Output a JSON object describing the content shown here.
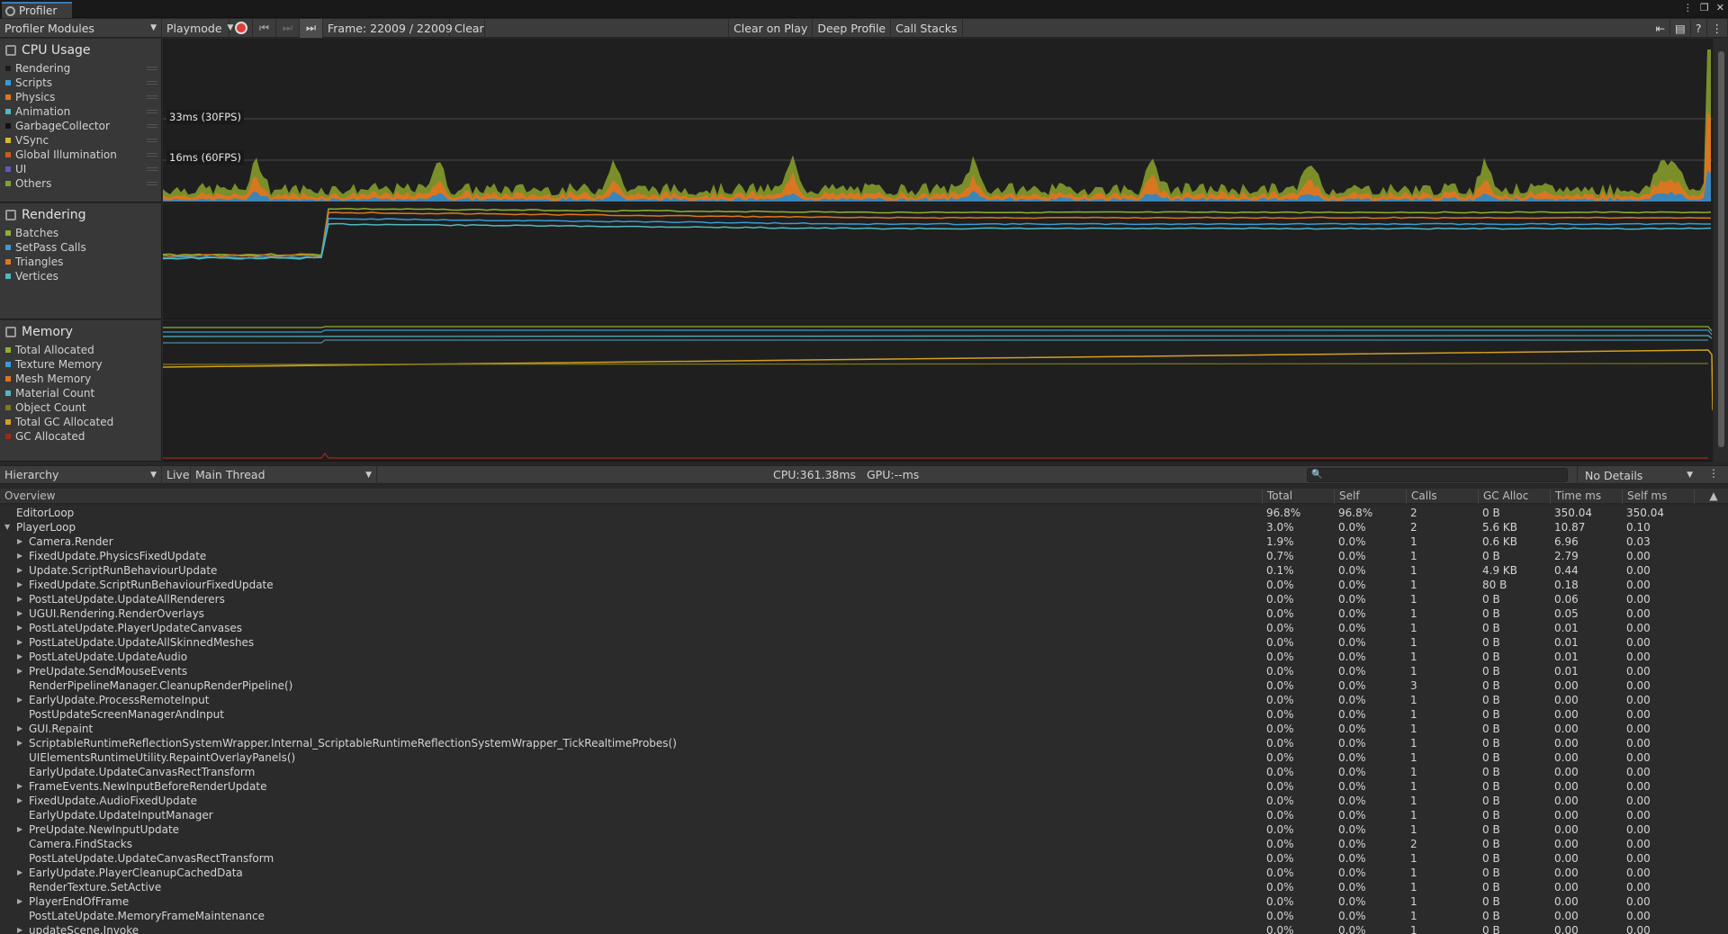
{
  "window": {
    "tab_title": "Profiler"
  },
  "toolbar": {
    "modules_label": "Profiler Modules",
    "playmode_label": "Playmode",
    "frame_label": "Frame: 22009 / 22009",
    "clear": "Clear",
    "clear_on_play": "Clear on Play",
    "deep_profile": "Deep Profile",
    "call_stacks": "Call Stacks"
  },
  "cpu_module": {
    "title": "CPU Usage",
    "legend": [
      {
        "name": "Rendering",
        "color": "#1c1c1c"
      },
      {
        "name": "Scripts",
        "color": "#3a9bd4"
      },
      {
        "name": "Physics",
        "color": "#e0761c"
      },
      {
        "name": "Animation",
        "color": "#4fb8c0"
      },
      {
        "name": "GarbageCollector",
        "color": "#111111"
      },
      {
        "name": "VSync",
        "color": "#d3b92a"
      },
      {
        "name": "Global Illumination",
        "color": "#cc5a1e"
      },
      {
        "name": "UI",
        "color": "#5d5ab8"
      },
      {
        "name": "Others",
        "color": "#7fa32c"
      }
    ],
    "fps_30": "33ms (30FPS)",
    "fps_60": "16ms (60FPS)"
  },
  "rendering_module": {
    "title": "Rendering",
    "legend": [
      {
        "name": "Batches",
        "color": "#8fb02d"
      },
      {
        "name": "SetPass Calls",
        "color": "#3a9bd4"
      },
      {
        "name": "Triangles",
        "color": "#e0761c"
      },
      {
        "name": "Vertices",
        "color": "#4fb8c0"
      }
    ]
  },
  "memory_module": {
    "title": "Memory",
    "legend": [
      {
        "name": "Total Allocated",
        "color": "#8fb02d"
      },
      {
        "name": "Texture Memory",
        "color": "#3a9bd4"
      },
      {
        "name": "Mesh Memory",
        "color": "#e0761c"
      },
      {
        "name": "Material Count",
        "color": "#4fb8c0"
      },
      {
        "name": "Object Count",
        "color": "#7c7a1c"
      },
      {
        "name": "Total GC Allocated",
        "color": "#d3a020"
      },
      {
        "name": "GC Allocated",
        "color": "#9c2a1c"
      }
    ]
  },
  "details_toolbar": {
    "view": "Hierarchy",
    "live": "Live",
    "thread": "Main Thread",
    "cpu_gpu": "CPU:361.38ms   GPU:--ms",
    "search_placeholder": "",
    "details": "No Details"
  },
  "table": {
    "headers": [
      "Overview",
      "Total",
      "Self",
      "Calls",
      "GC Alloc",
      "Time ms",
      "Self ms"
    ],
    "rows": [
      {
        "name": "EditorLoop",
        "depth": 0,
        "exp": "",
        "total": "96.8%",
        "self": "96.8%",
        "calls": "2",
        "gc": "0 B",
        "time": "350.04",
        "selfms": "350.04"
      },
      {
        "name": "PlayerLoop",
        "depth": 0,
        "exp": "▼",
        "total": "3.0%",
        "self": "0.0%",
        "calls": "2",
        "gc": "5.6 KB",
        "time": "10.87",
        "selfms": "0.10"
      },
      {
        "name": "Camera.Render",
        "depth": 1,
        "exp": "▶",
        "total": "1.9%",
        "self": "0.0%",
        "calls": "1",
        "gc": "0.6 KB",
        "time": "6.96",
        "selfms": "0.03"
      },
      {
        "name": "FixedUpdate.PhysicsFixedUpdate",
        "depth": 1,
        "exp": "▶",
        "total": "0.7%",
        "self": "0.0%",
        "calls": "1",
        "gc": "0 B",
        "time": "2.79",
        "selfms": "0.00"
      },
      {
        "name": "Update.ScriptRunBehaviourUpdate",
        "depth": 1,
        "exp": "▶",
        "total": "0.1%",
        "self": "0.0%",
        "calls": "1",
        "gc": "4.9 KB",
        "time": "0.44",
        "selfms": "0.00"
      },
      {
        "name": "FixedUpdate.ScriptRunBehaviourFixedUpdate",
        "depth": 1,
        "exp": "▶",
        "total": "0.0%",
        "self": "0.0%",
        "calls": "1",
        "gc": "80 B",
        "time": "0.18",
        "selfms": "0.00"
      },
      {
        "name": "PostLateUpdate.UpdateAllRenderers",
        "depth": 1,
        "exp": "▶",
        "total": "0.0%",
        "self": "0.0%",
        "calls": "1",
        "gc": "0 B",
        "time": "0.06",
        "selfms": "0.00"
      },
      {
        "name": "UGUI.Rendering.RenderOverlays",
        "depth": 1,
        "exp": "▶",
        "total": "0.0%",
        "self": "0.0%",
        "calls": "1",
        "gc": "0 B",
        "time": "0.05",
        "selfms": "0.00"
      },
      {
        "name": "PostLateUpdate.PlayerUpdateCanvases",
        "depth": 1,
        "exp": "▶",
        "total": "0.0%",
        "self": "0.0%",
        "calls": "1",
        "gc": "0 B",
        "time": "0.01",
        "selfms": "0.00"
      },
      {
        "name": "PostLateUpdate.UpdateAllSkinnedMeshes",
        "depth": 1,
        "exp": "▶",
        "total": "0.0%",
        "self": "0.0%",
        "calls": "1",
        "gc": "0 B",
        "time": "0.01",
        "selfms": "0.00"
      },
      {
        "name": "PostLateUpdate.UpdateAudio",
        "depth": 1,
        "exp": "▶",
        "total": "0.0%",
        "self": "0.0%",
        "calls": "1",
        "gc": "0 B",
        "time": "0.01",
        "selfms": "0.00"
      },
      {
        "name": "PreUpdate.SendMouseEvents",
        "depth": 1,
        "exp": "▶",
        "total": "0.0%",
        "self": "0.0%",
        "calls": "1",
        "gc": "0 B",
        "time": "0.01",
        "selfms": "0.00"
      },
      {
        "name": "RenderPipelineManager.CleanupRenderPipeline()",
        "depth": 1,
        "exp": "",
        "total": "0.0%",
        "self": "0.0%",
        "calls": "3",
        "gc": "0 B",
        "time": "0.00",
        "selfms": "0.00"
      },
      {
        "name": "EarlyUpdate.ProcessRemoteInput",
        "depth": 1,
        "exp": "▶",
        "total": "0.0%",
        "self": "0.0%",
        "calls": "1",
        "gc": "0 B",
        "time": "0.00",
        "selfms": "0.00"
      },
      {
        "name": "PostUpdateScreenManagerAndInput",
        "depth": 1,
        "exp": "",
        "total": "0.0%",
        "self": "0.0%",
        "calls": "1",
        "gc": "0 B",
        "time": "0.00",
        "selfms": "0.00"
      },
      {
        "name": "GUI.Repaint",
        "depth": 1,
        "exp": "▶",
        "total": "0.0%",
        "self": "0.0%",
        "calls": "1",
        "gc": "0 B",
        "time": "0.00",
        "selfms": "0.00"
      },
      {
        "name": "ScriptableRuntimeReflectionSystemWrapper.Internal_ScriptableRuntimeReflectionSystemWrapper_TickRealtimeProbes()",
        "depth": 1,
        "exp": "▶",
        "total": "0.0%",
        "self": "0.0%",
        "calls": "1",
        "gc": "0 B",
        "time": "0.00",
        "selfms": "0.00"
      },
      {
        "name": "UIElementsRuntimeUtility.RepaintOverlayPanels()",
        "depth": 1,
        "exp": "",
        "total": "0.0%",
        "self": "0.0%",
        "calls": "1",
        "gc": "0 B",
        "time": "0.00",
        "selfms": "0.00"
      },
      {
        "name": "EarlyUpdate.UpdateCanvasRectTransform",
        "depth": 1,
        "exp": "",
        "total": "0.0%",
        "self": "0.0%",
        "calls": "1",
        "gc": "0 B",
        "time": "0.00",
        "selfms": "0.00"
      },
      {
        "name": "FrameEvents.NewInputBeforeRenderUpdate",
        "depth": 1,
        "exp": "▶",
        "total": "0.0%",
        "self": "0.0%",
        "calls": "1",
        "gc": "0 B",
        "time": "0.00",
        "selfms": "0.00"
      },
      {
        "name": "FixedUpdate.AudioFixedUpdate",
        "depth": 1,
        "exp": "▶",
        "total": "0.0%",
        "self": "0.0%",
        "calls": "1",
        "gc": "0 B",
        "time": "0.00",
        "selfms": "0.00"
      },
      {
        "name": "EarlyUpdate.UpdateInputManager",
        "depth": 1,
        "exp": "",
        "total": "0.0%",
        "self": "0.0%",
        "calls": "1",
        "gc": "0 B",
        "time": "0.00",
        "selfms": "0.00"
      },
      {
        "name": "PreUpdate.NewInputUpdate",
        "depth": 1,
        "exp": "▶",
        "total": "0.0%",
        "self": "0.0%",
        "calls": "1",
        "gc": "0 B",
        "time": "0.00",
        "selfms": "0.00"
      },
      {
        "name": "Camera.FindStacks",
        "depth": 1,
        "exp": "",
        "total": "0.0%",
        "self": "0.0%",
        "calls": "2",
        "gc": "0 B",
        "time": "0.00",
        "selfms": "0.00"
      },
      {
        "name": "PostLateUpdate.UpdateCanvasRectTransform",
        "depth": 1,
        "exp": "",
        "total": "0.0%",
        "self": "0.0%",
        "calls": "1",
        "gc": "0 B",
        "time": "0.00",
        "selfms": "0.00"
      },
      {
        "name": "EarlyUpdate.PlayerCleanupCachedData",
        "depth": 1,
        "exp": "▶",
        "total": "0.0%",
        "self": "0.0%",
        "calls": "1",
        "gc": "0 B",
        "time": "0.00",
        "selfms": "0.00"
      },
      {
        "name": "RenderTexture.SetActive",
        "depth": 1,
        "exp": "",
        "total": "0.0%",
        "self": "0.0%",
        "calls": "1",
        "gc": "0 B",
        "time": "0.00",
        "selfms": "0.00"
      },
      {
        "name": "PlayerEndOfFrame",
        "depth": 1,
        "exp": "▶",
        "total": "0.0%",
        "self": "0.0%",
        "calls": "1",
        "gc": "0 B",
        "time": "0.00",
        "selfms": "0.00"
      },
      {
        "name": "PostLateUpdate.MemoryFrameMaintenance",
        "depth": 1,
        "exp": "",
        "total": "0.0%",
        "self": "0.0%",
        "calls": "1",
        "gc": "0 B",
        "time": "0.00",
        "selfms": "0.00"
      },
      {
        "name": "updateScene.Invoke",
        "depth": 1,
        "exp": "▶",
        "total": "0.0%",
        "self": "0.0%",
        "calls": "1",
        "gc": "0 B",
        "time": "0.00",
        "selfms": "0.00"
      }
    ]
  }
}
